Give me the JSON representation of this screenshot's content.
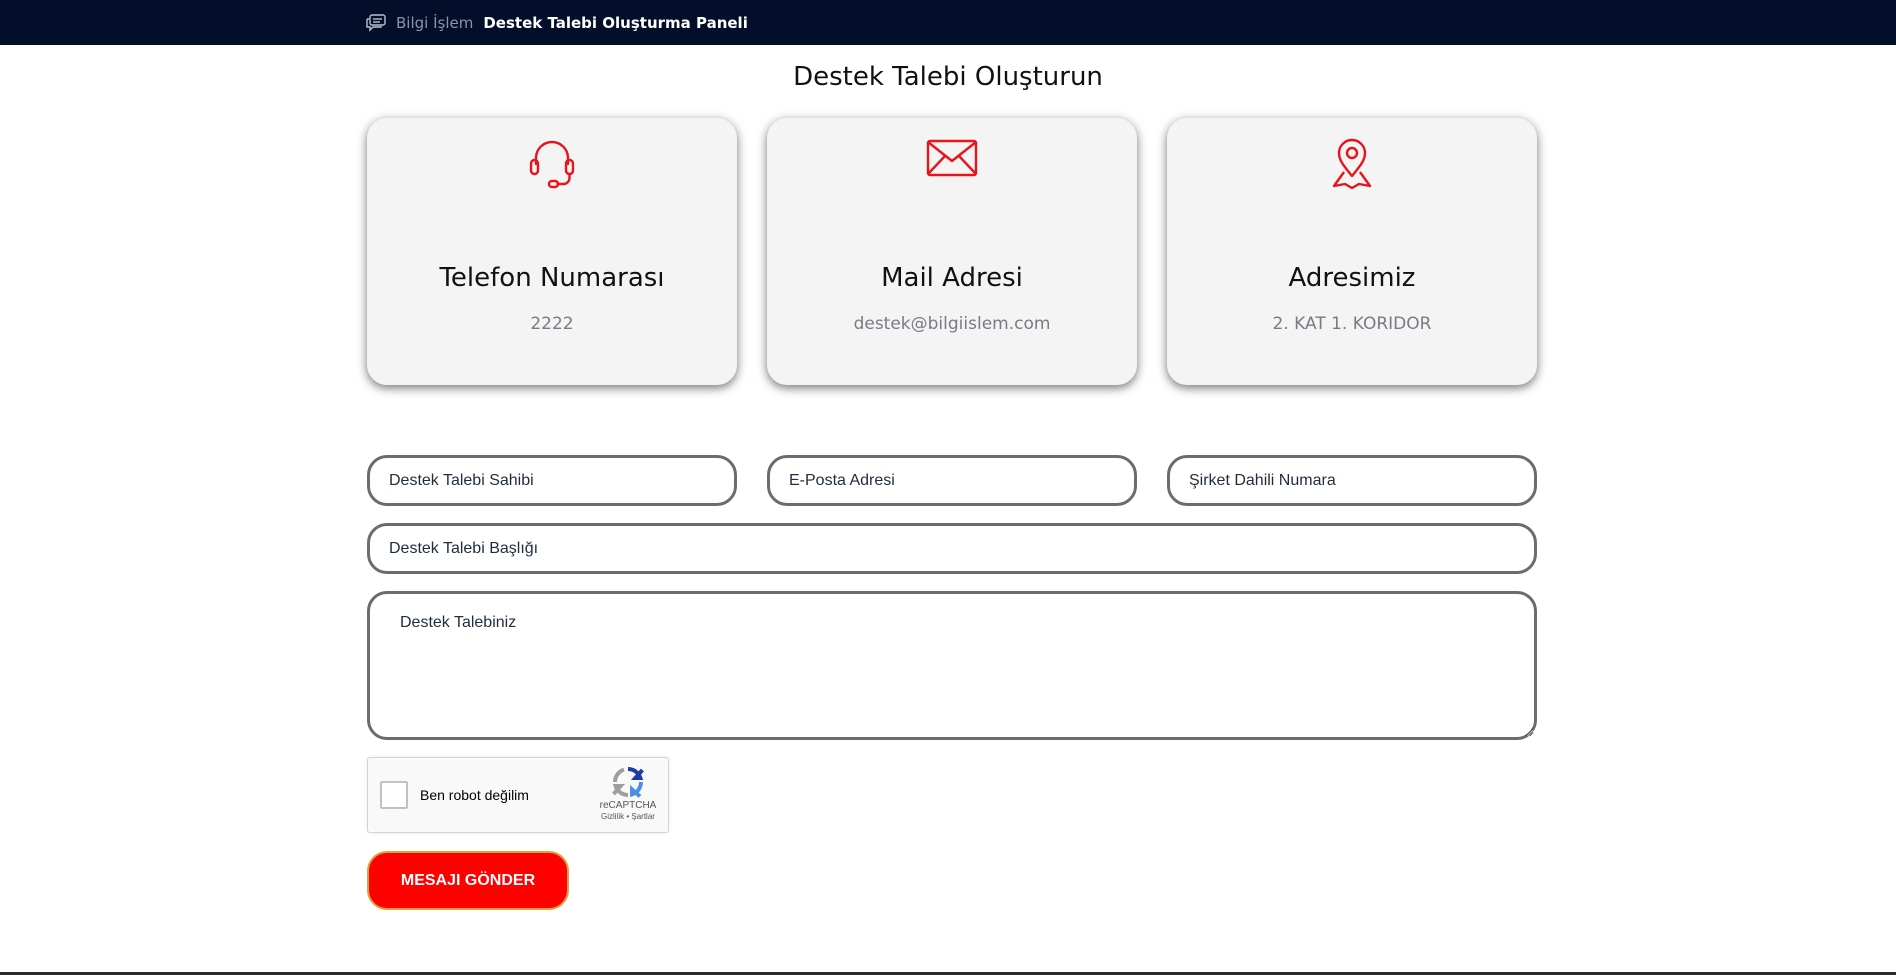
{
  "header": {
    "brand_muted": "Bilgi İşlem",
    "brand_main": "Destek Talebi Oluşturma Paneli",
    "icon": "chat-bubbles-icon"
  },
  "main": {
    "title": "Destek Talebi Oluşturun"
  },
  "cards": [
    {
      "icon": "headset-icon",
      "title": "Telefon Numarası",
      "value": "2222"
    },
    {
      "icon": "envelope-icon",
      "title": "Mail Adresi",
      "value": "destek@bilgiislem.com"
    },
    {
      "icon": "map-pin-icon",
      "title": "Adresimiz",
      "value": "2. KAT 1. KORIDOR"
    }
  ],
  "form": {
    "name_placeholder": "Destek Talebi Sahibi",
    "email_placeholder": "E-Posta Adresi",
    "phone_placeholder": "Şirket Dahili Numara",
    "subject_placeholder": "Destek Talebi Başlığı",
    "message_placeholder": "Destek Talebiniz",
    "submit_label": "MESAJI GÖNDER"
  },
  "captcha": {
    "label": "Ben robot değilim",
    "brand": "reCAPTCHA",
    "links": "Gizlilik • Şartlar",
    "icon": "recaptcha-icon"
  },
  "colors": {
    "header_bg": "#030f2a",
    "accent": "#ff0000",
    "card_bg": "#f4f4f4"
  }
}
